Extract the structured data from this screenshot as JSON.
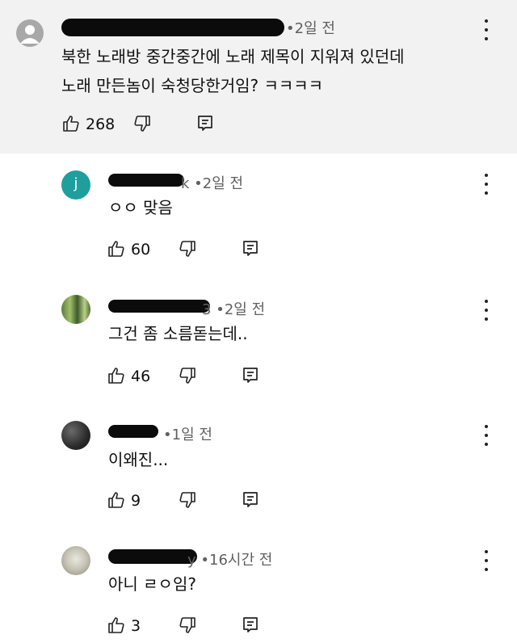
{
  "comments": [
    {
      "time": "2일 전",
      "text_lines": [
        "북한 노래방 중간중간에 노래 제목이 지워져 있던데",
        "노래 만든놈이 숙청당한거임? ㅋㅋㅋㅋ"
      ],
      "likes": "268",
      "avatar_letter": ""
    },
    {
      "name_suffix": "k",
      "time": "2일 전",
      "text": "ㅇㅇ 맞음",
      "likes": "60",
      "avatar_letter": "j"
    },
    {
      "name_suffix": "3",
      "time": "2일 전",
      "text": "그건 좀 소름돋는데..",
      "likes": "46"
    },
    {
      "time": "1일 전",
      "text": "이왜진...",
      "likes": "9"
    },
    {
      "name_suffix": "y",
      "time": "16시간 전",
      "text": "아니 ㄹㅇ임?",
      "likes": "3"
    }
  ],
  "separator": "•",
  "colors": {
    "top_bg": "#f2f2f2",
    "avatar_j": "#1f9e9e",
    "meta": "#606060"
  },
  "icons": [
    "default-avatar-icon",
    "thumbs-up-icon",
    "thumbs-down-icon",
    "reply-icon",
    "more-vert-icon"
  ]
}
